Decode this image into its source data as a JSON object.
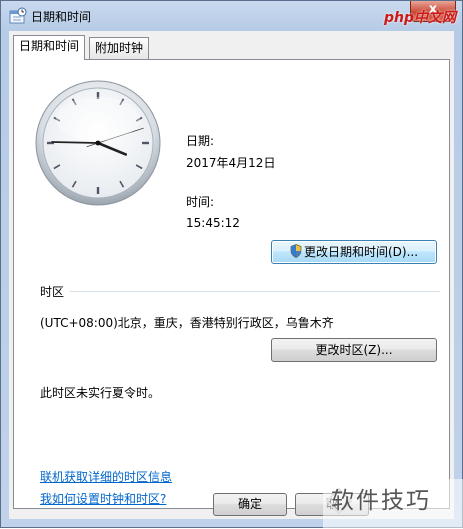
{
  "window": {
    "title": "日期和时间",
    "close_glyph": "x",
    "watermark_top": "php中文网"
  },
  "tabs": [
    {
      "label": "日期和时间",
      "active": true
    },
    {
      "label": "附加时钟",
      "active": false
    }
  ],
  "clock": {
    "hour": 15,
    "minute": 45,
    "second": 12
  },
  "date": {
    "label": "日期:",
    "value": "2017年4月12日"
  },
  "time": {
    "label": "时间:",
    "value": "15:45:12"
  },
  "buttons": {
    "change_datetime": "更改日期和时间(D)...",
    "change_timezone": "更改时区(Z)...",
    "ok": "确定",
    "cancel": "取"
  },
  "timezone": {
    "section_label": "时区",
    "value": "(UTC+08:00)北京，重庆，香港特别行政区，乌鲁木齐",
    "dst_note": "此时区未实行夏令时。"
  },
  "links": {
    "online_info": "联机获取详细的时区信息",
    "how_to_set": "我如何设置时钟和时区?"
  },
  "watermark": {
    "text": "软件技巧"
  },
  "colors": {
    "link": "#0066cc",
    "window_frame": "#b6cbe6",
    "close_button": "#c7432f"
  }
}
